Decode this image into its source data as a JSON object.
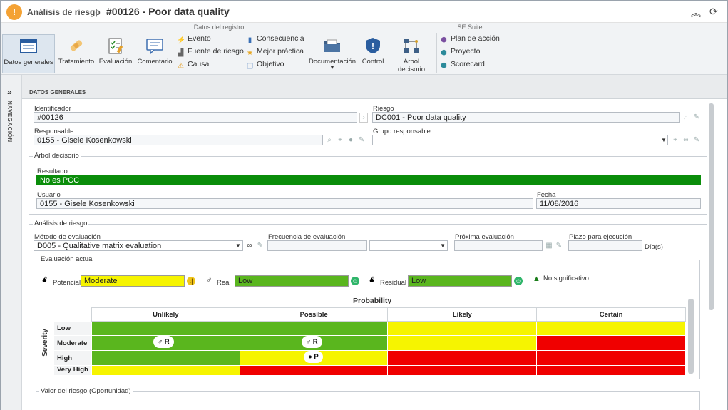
{
  "titlebar": {
    "app": "Análisis de riesgo",
    "sep": "|",
    "title": "#00126 - Poor data quality",
    "collapse": "︽",
    "refresh": "⟳"
  },
  "ribbon": {
    "group1": "Datos del registro",
    "group2": "SE Suite",
    "big": [
      {
        "label": "Datos generales"
      },
      {
        "label": "Tratamiento"
      },
      {
        "label": "Evaluación"
      },
      {
        "label": "Comentario"
      },
      {
        "label": "Documentación"
      },
      {
        "label": "Control"
      },
      {
        "label": "Árbol decisorio"
      }
    ],
    "small1": [
      "Evento",
      "Fuente de riesgo",
      "Causa"
    ],
    "small2": [
      "Consecuencia",
      "Mejor práctica",
      "Objetivo"
    ],
    "small3": [
      "Plan de acción",
      "Proyecto",
      "Scorecard"
    ]
  },
  "nav": {
    "arrow": "»",
    "label": "NAVEGACIÓN"
  },
  "section": {
    "title": "DATOS GENERALES"
  },
  "general": {
    "id_label": "Identificador",
    "id_value": "#00126",
    "riesgo_label": "Riesgo",
    "riesgo_value": "DC001 - Poor data quality",
    "resp_label": "Responsable",
    "resp_value": "0155 - Gisele Kosenkowski",
    "grupo_label": "Grupo responsable",
    "grupo_value": ""
  },
  "arbol": {
    "legend": "Árbol decisorio",
    "resultado_label": "Resultado",
    "resultado_value": "No es PCC",
    "usuario_label": "Usuario",
    "usuario_value": "0155 - Gisele Kosenkowski",
    "fecha_label": "Fecha",
    "fecha_value": "11/08/2016"
  },
  "analisis": {
    "legend": "Análisis de riesgo",
    "metodo_label": "Método de evaluación",
    "metodo_value": "D005 - Qualitative matrix evaluation",
    "frecuencia_label": "Frecuencia de evaluación",
    "proxima_label": "Próxima evaluación",
    "plazo_label": "Plazo para ejecución",
    "plazo_unit": "Día(s)",
    "eval_legend": "Evaluación actual",
    "potencial_label": "Potencial",
    "potencial_value": "Moderate",
    "real_label": "Real",
    "real_value": "Low",
    "residual_label": "Residual",
    "residual_value": "Low",
    "no_sig": "No significativo",
    "valor_legend": "Valor del riesgo (Oportunidad)"
  },
  "matrix": {
    "prob_title": "Probability",
    "sev_title": "Severity",
    "cols": [
      "Unlikely",
      "Possible",
      "Likely",
      "Certain"
    ],
    "rows": [
      "Low",
      "Moderate",
      "High",
      "Very High"
    ],
    "chips": [
      "R",
      "R",
      "P"
    ],
    "colors": {
      "green": "#5ab61e",
      "yellow": "#f6f400",
      "red": "#f00000"
    }
  }
}
